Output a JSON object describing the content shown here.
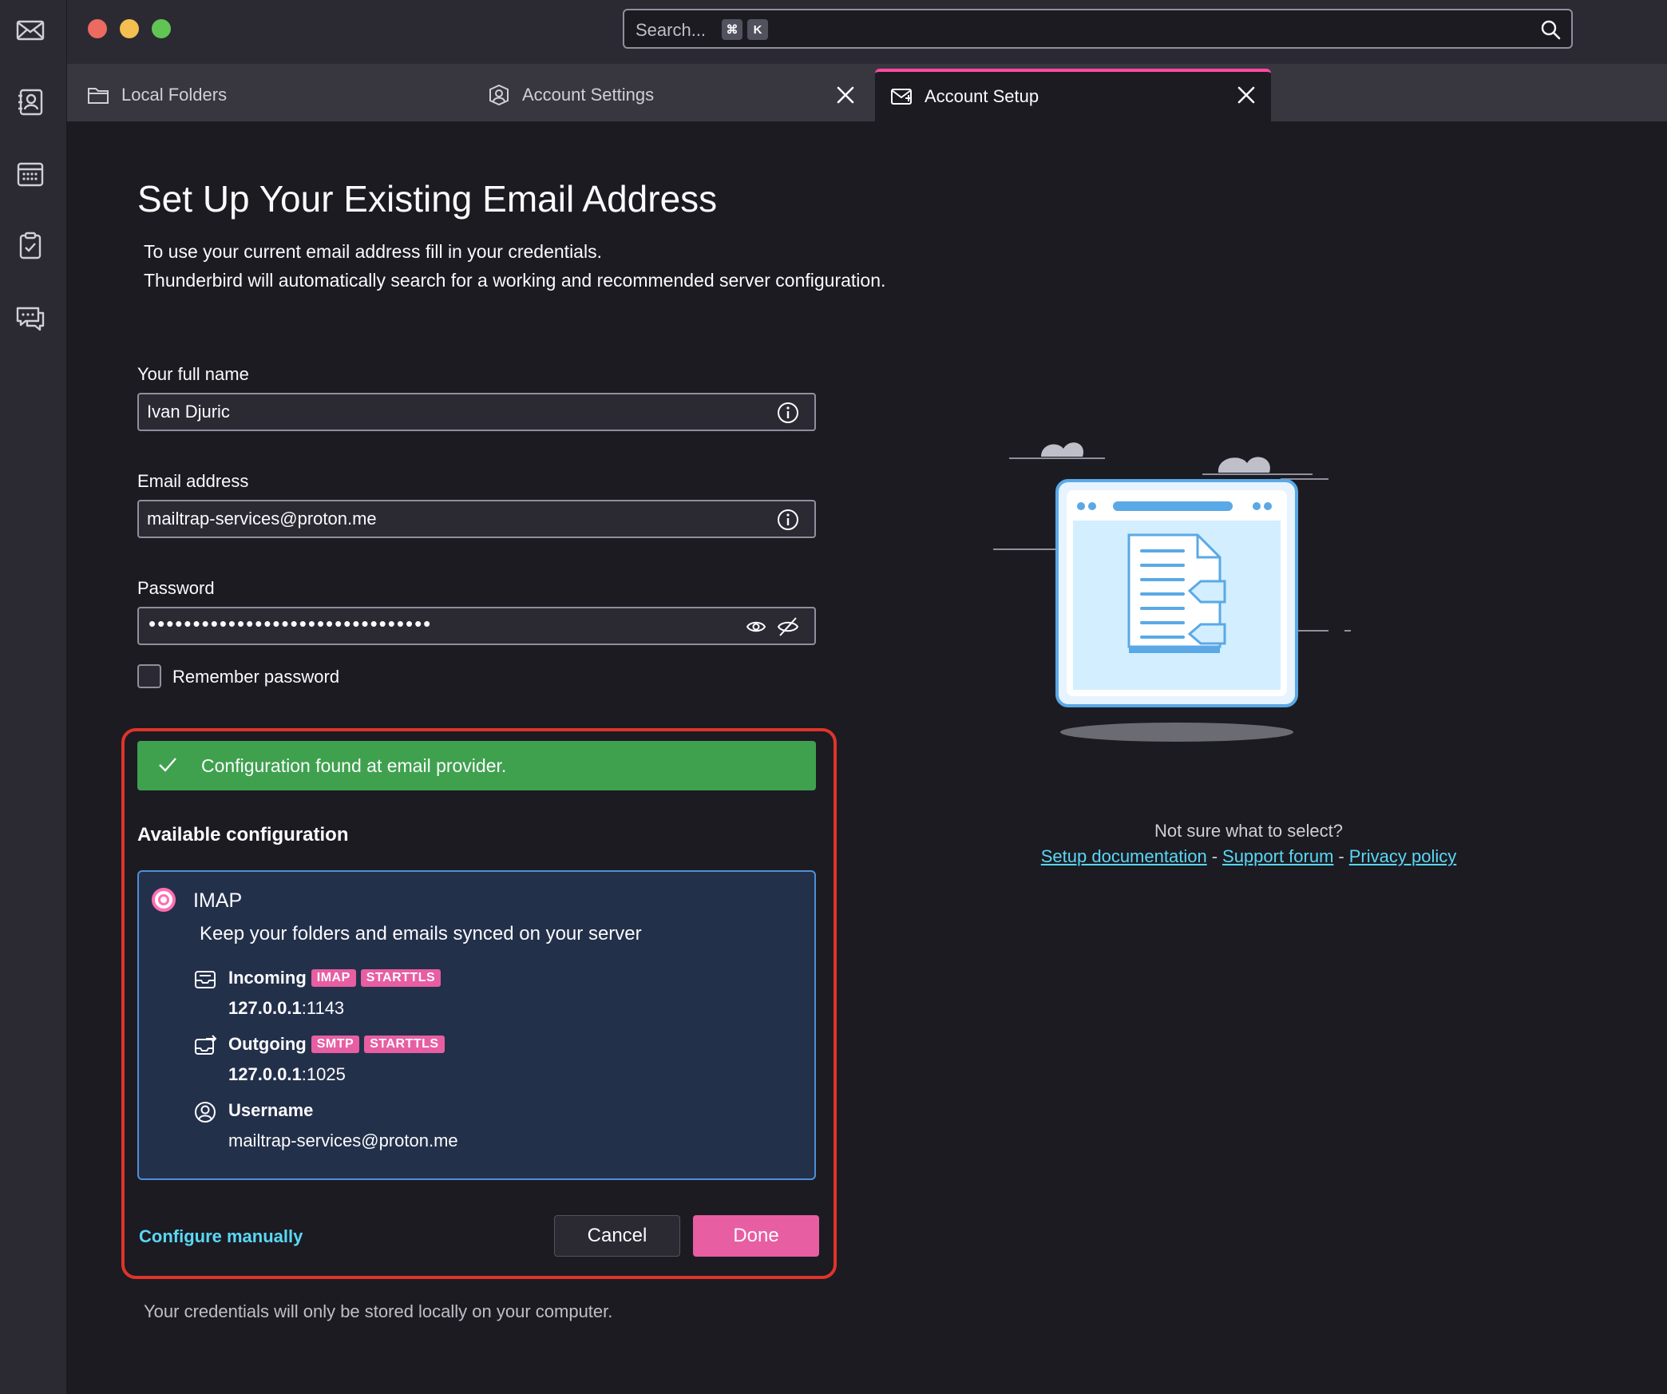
{
  "search": {
    "placeholder": "Search...",
    "shortcut_key1": "⌘",
    "shortcut_key2": "K"
  },
  "tabs": [
    {
      "label": "Local Folders",
      "icon": "folder-icon"
    },
    {
      "label": "Account Settings",
      "icon": "account-icon"
    },
    {
      "label": "Account Setup",
      "icon": "mail-setup-icon",
      "active": true
    }
  ],
  "page": {
    "title": "Set Up Your Existing Email Address",
    "intro_line1": "To use your current email address fill in your credentials.",
    "intro_line2": "Thunderbird will automatically search for a working and recommended server configuration."
  },
  "form": {
    "name_label": "Your full name",
    "name_value": "Ivan Djuric",
    "email_label": "Email address",
    "email_value": "mailtrap-services@proton.me",
    "password_label": "Password",
    "password_mask": "••••••••••••••••••••••••••••••••",
    "remember_label": "Remember password",
    "remember_checked": false
  },
  "result": {
    "notice": "Configuration found at email provider.",
    "available_heading": "Available configuration",
    "protocol": "IMAP",
    "protocol_desc": "Keep your folders and emails synced on your server",
    "incoming_label": "Incoming",
    "incoming_badges": [
      "IMAP",
      "STARTTLS"
    ],
    "incoming_host": "127.0.0.1",
    "incoming_port": ":1143",
    "outgoing_label": "Outgoing",
    "outgoing_badges": [
      "SMTP",
      "STARTTLS"
    ],
    "outgoing_host": "127.0.0.1",
    "outgoing_port": ":1025",
    "username_label": "Username",
    "username_value": "mailtrap-services@proton.me"
  },
  "actions": {
    "configure_manually": "Configure manually",
    "cancel": "Cancel",
    "done": "Done"
  },
  "footer_note": "Your credentials will only be stored locally on your computer.",
  "help": {
    "question": "Not sure what to select?",
    "setup_doc": "Setup documentation",
    "support_forum": "Support forum",
    "privacy_policy": "Privacy policy",
    "separator": "-"
  },
  "colors": {
    "accent": "#e85ea2",
    "success": "#3fa14e",
    "link": "#5ad7f5",
    "highlight_border": "#e0342a",
    "config_bg": "#23304a"
  }
}
